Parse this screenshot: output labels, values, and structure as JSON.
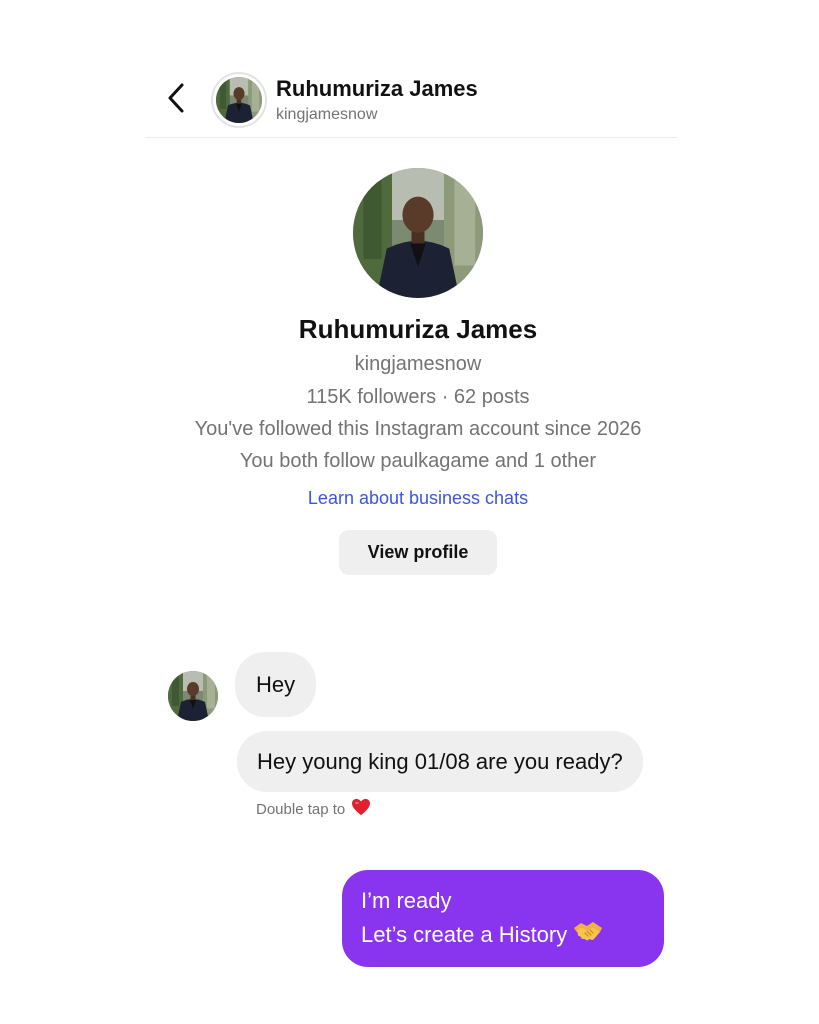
{
  "header": {
    "name": "Ruhumuriza James",
    "username": "kingjamesnow",
    "back_icon": "chevron-left-icon"
  },
  "profile": {
    "name": "Ruhumuriza James",
    "username": "kingjamesnow",
    "stats": "115K followers · 62 posts",
    "followed_since": "You've followed this Instagram account since 2026",
    "mutual": "You both follow paulkagame and 1 other",
    "business_link": "Learn about business chats",
    "view_profile_label": "View profile"
  },
  "messages": {
    "incoming": [
      {
        "text": "Hey"
      },
      {
        "text": "Hey young king 01/08 are you ready?"
      }
    ],
    "double_tap_hint": "Double tap to",
    "double_tap_icon": "red-heart-icon",
    "outgoing": {
      "line1": "I’m ready",
      "line2": "Let’s create a History",
      "emoji_icon": "handshake-icon"
    }
  },
  "colors": {
    "outgoing_bubble": "#8934ee",
    "incoming_bubble": "#efefef",
    "link": "#3a55e0",
    "secondary_text": "#737373",
    "heart": "#e0202e"
  }
}
